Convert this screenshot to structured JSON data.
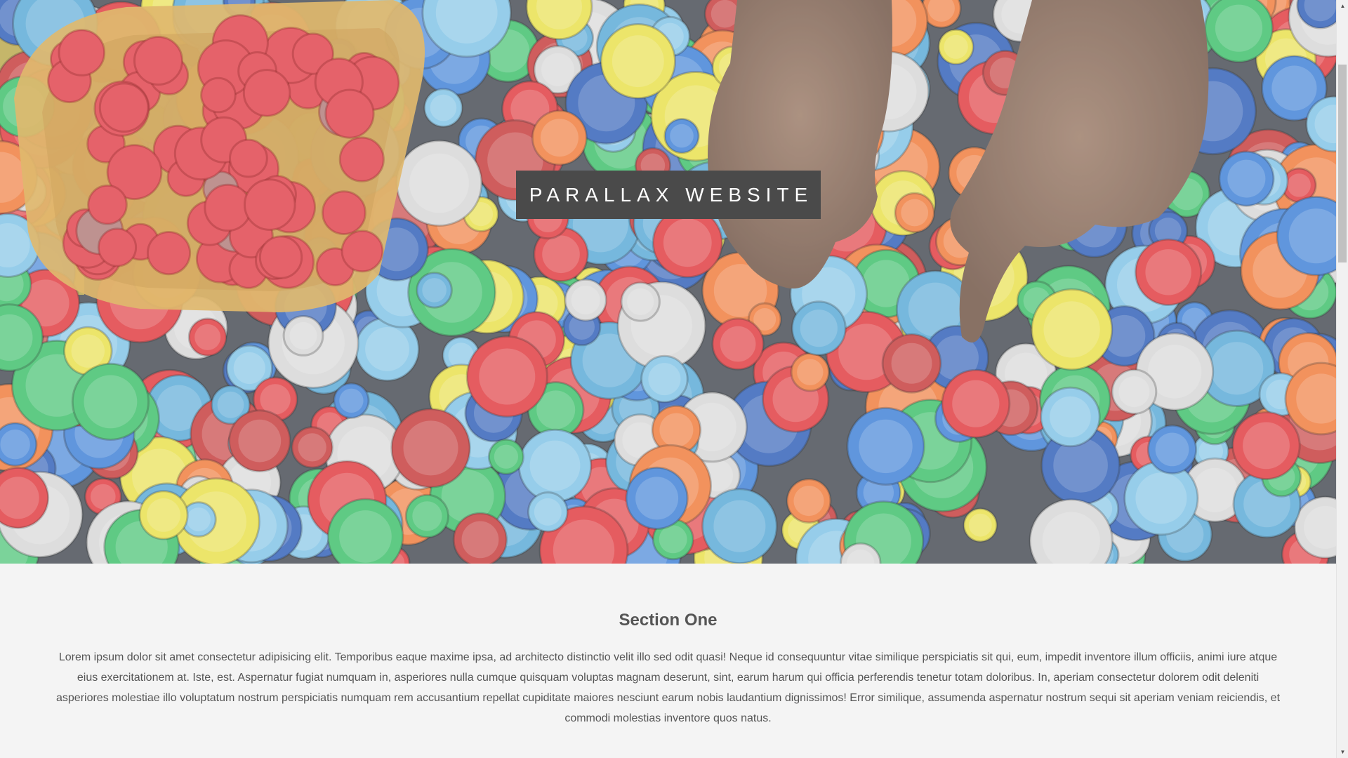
{
  "hero": {
    "title": "PARALLAX WEBSITE",
    "image_subject": "bottle-caps-photo"
  },
  "section_one": {
    "heading": "Section One",
    "body": "Lorem ipsum dolor sit amet consectetur adipisicing elit. Temporibus eaque maxime ipsa, ad architecto distinctio velit illo sed odit quasi! Neque id consequuntur vitae similique perspiciatis sit qui, eum, impedit inventore illum officiis, animi iure atque eius exercitationem at. Iste, est. Aspernatur fugiat numquam in, asperiores nulla cumque quisquam voluptas magnam deserunt, sint, earum harum qui officia perferendis tenetur totam doloribus. In, aperiam consectetur dolorem odit deleniti asperiores molestiae illo voluptatum nostrum perspiciatis numquam rem accusantium repellat cupiditate maiores nesciunt earum nobis laudantium dignissimos! Error similique, assumenda aspernatur nostrum sequi sit aperiam veniam reiciendis, et commodi molestias inventore quos natus."
  },
  "colors": {
    "page_background": "#f4f4f4",
    "title_box": "#4a4a4a",
    "text": "#555555"
  },
  "scrollbar": {
    "up_icon": "chevron-up-icon",
    "down_icon": "chevron-down-icon"
  }
}
